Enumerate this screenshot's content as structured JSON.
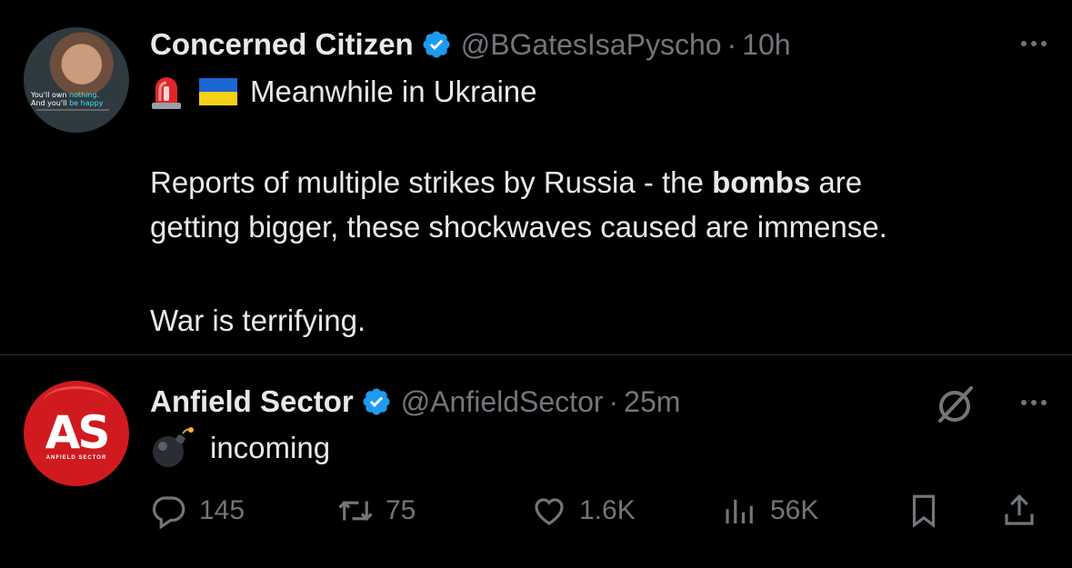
{
  "tweets": [
    {
      "author": "Concerned Citizen",
      "handle": "@BGatesIsaPyscho",
      "time_sep": "·",
      "time": "10h",
      "line1_text": "Meanwhile in Ukraine",
      "para_before": "Reports of multiple strikes by Russia - the ",
      "para_bold": "bombs",
      "para_after": " are",
      "para_line2": "getting bigger, these shockwaves caused are immense.",
      "para2": "War is terrifying.",
      "avatar_caption_1a": "You'll own ",
      "avatar_caption_1b": "nothing.",
      "avatar_caption_2a": "And you'll ",
      "avatar_caption_2b": "be happy"
    },
    {
      "author": "Anfield Sector",
      "handle": "@AnfieldSector",
      "time_sep": "·",
      "time": "25m",
      "text": "incoming",
      "avatar_logo": "AS",
      "avatar_sub": "ANFIELD SECTOR",
      "stats": {
        "replies": "145",
        "reposts": "75",
        "likes": "1.6K",
        "views": "56K"
      }
    }
  ],
  "colors": {
    "background": "#000000",
    "text": "#e7e9ea",
    "secondary": "#71767b",
    "verified": "#1d9bf0",
    "divider": "#2f3336"
  },
  "icons": [
    "verified-badge-icon",
    "siren-emoji",
    "ukraine-flag-emoji",
    "bomb-emoji",
    "grok-icon",
    "more-icon",
    "reply-icon",
    "repost-icon",
    "like-icon",
    "views-icon",
    "bookmark-icon",
    "share-icon"
  ]
}
